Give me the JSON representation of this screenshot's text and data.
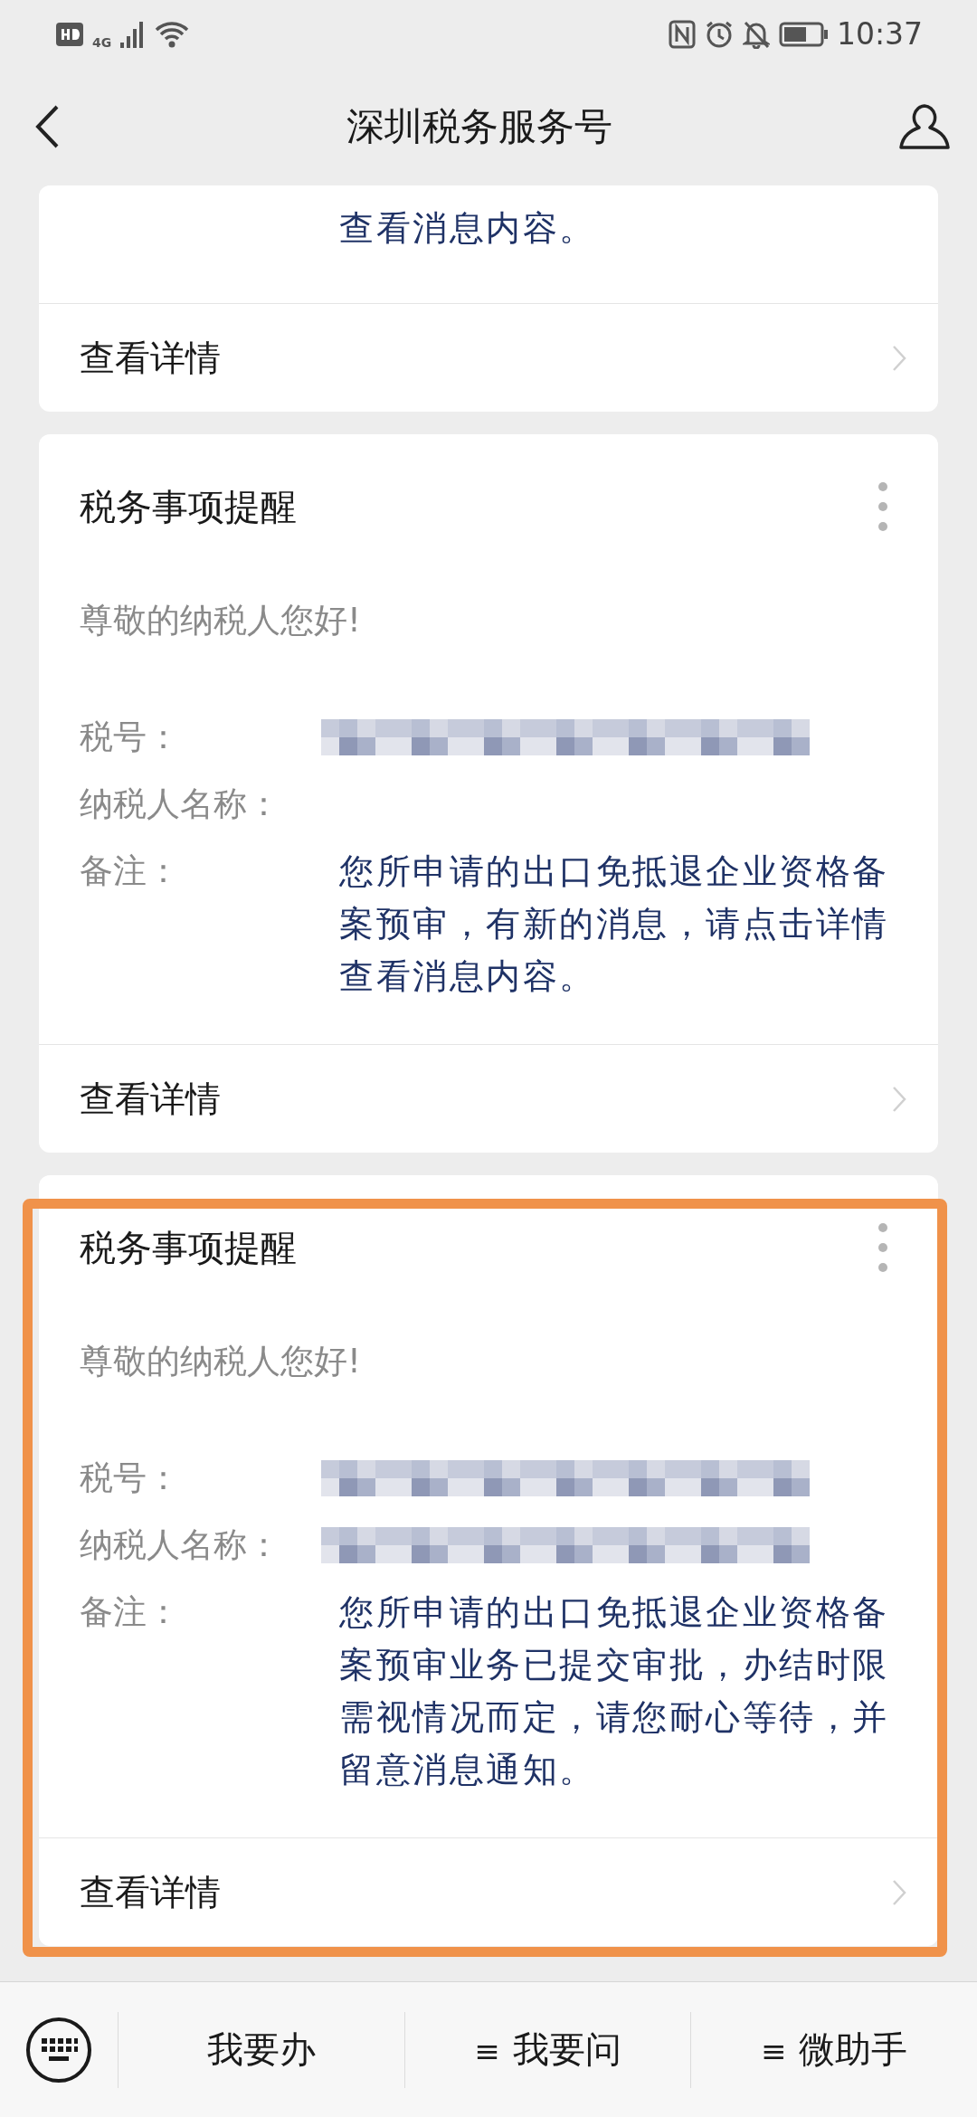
{
  "status_bar": {
    "time": "10:37",
    "network": "4G"
  },
  "header": {
    "title": "深圳税务服务号"
  },
  "cards": [
    {
      "fields": [
        {
          "kind": "text",
          "value": "查看消息内容。"
        }
      ],
      "link": "查看详情",
      "highlighted": false
    },
    {
      "title": "税务事项提醒",
      "greeting": "尊敬的纳税人您好!",
      "fields": [
        {
          "label": "税号：",
          "kind": "redacted"
        },
        {
          "label": "纳税人名称：",
          "kind": "blank"
        },
        {
          "label": "备注：",
          "kind": "text",
          "value": "您所申请的出口免抵退企业资格备案预审，有新的消息，请点击详情查看消息内容。"
        }
      ],
      "link": "查看详情",
      "highlighted": false
    },
    {
      "title": "税务事项提醒",
      "greeting": "尊敬的纳税人您好!",
      "fields": [
        {
          "label": "税号：",
          "kind": "redacted"
        },
        {
          "label": "纳税人名称：",
          "kind": "redacted"
        },
        {
          "label": "备注：",
          "kind": "text",
          "value": "您所申请的出口免抵退企业资格备案预审业务已提交审批，办结时限需视情况而定，请您耐心等待，并留意消息通知。"
        }
      ],
      "link": "查看详情",
      "highlighted": true
    }
  ],
  "bottom_menu": [
    {
      "label": "我要办"
    },
    {
      "prefix": "≡",
      "label": "我要问"
    },
    {
      "prefix": "≡",
      "label": "微助手"
    }
  ]
}
